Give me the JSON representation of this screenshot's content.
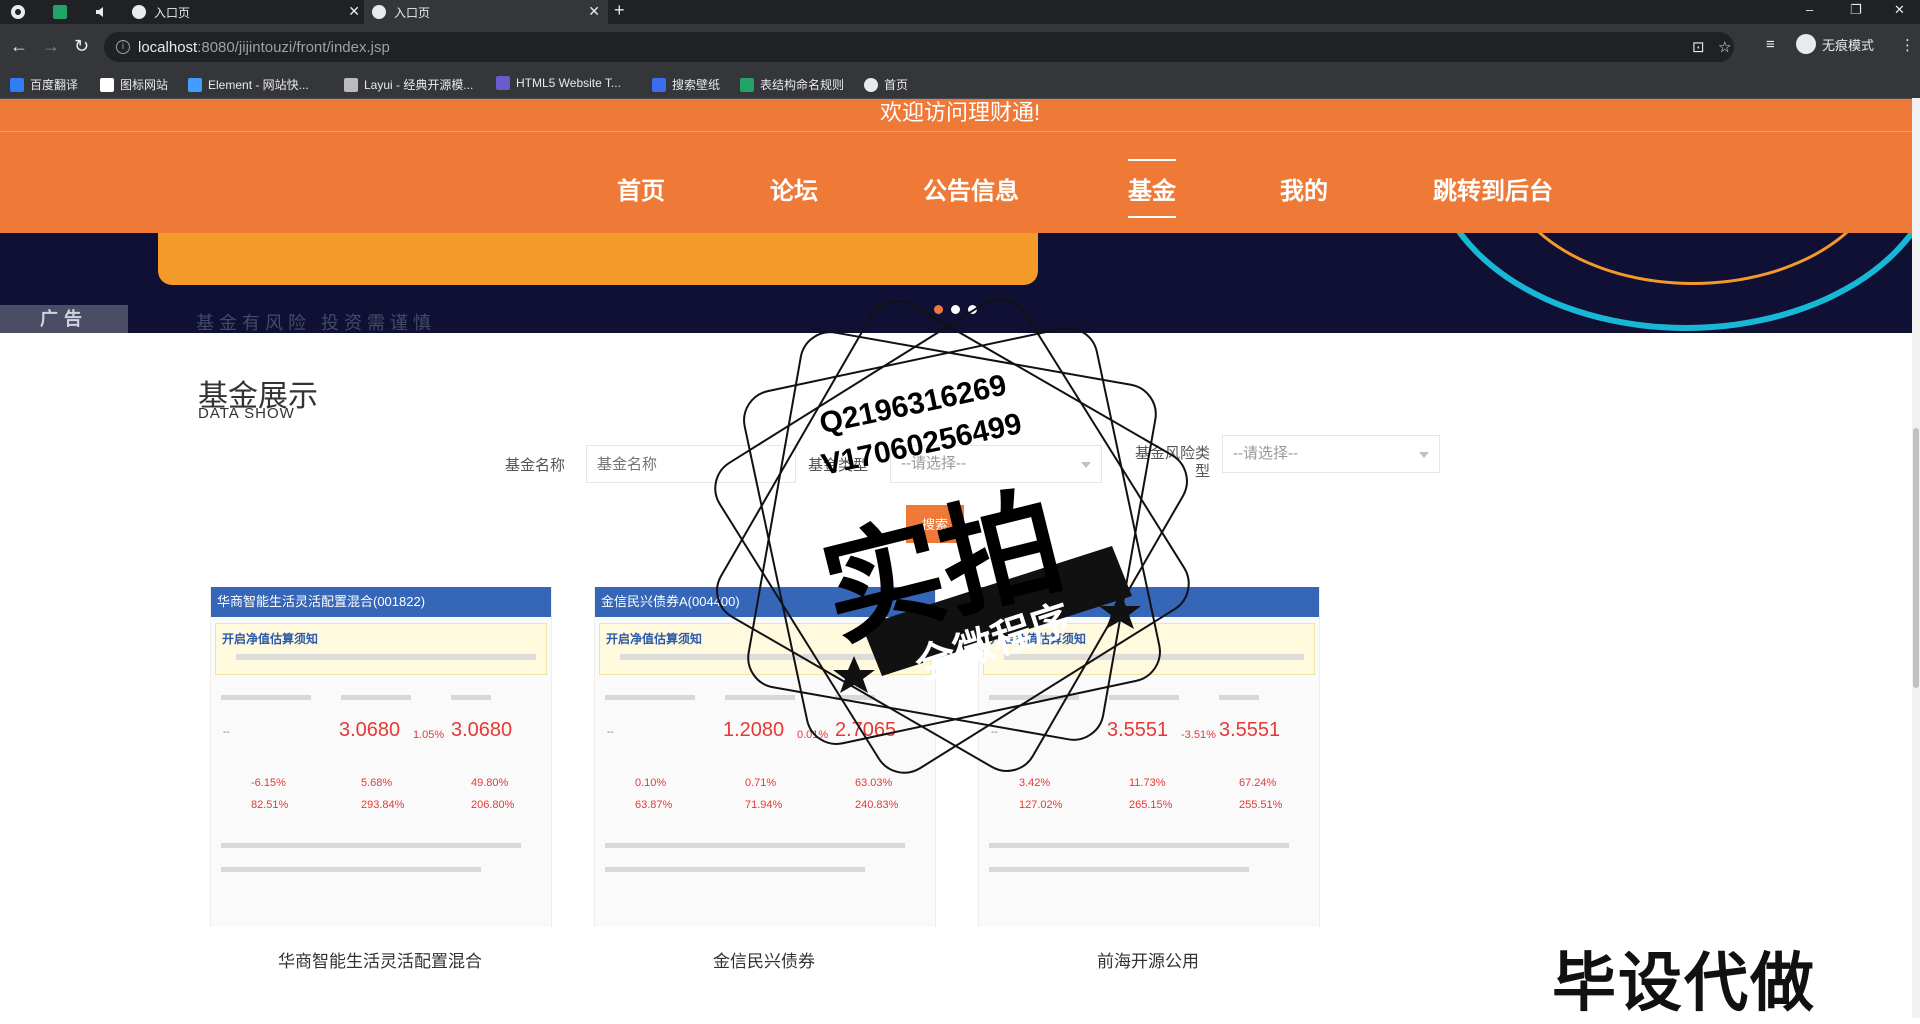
{
  "browser": {
    "tabs": [
      {
        "title": "入口页",
        "active": false
      },
      {
        "title": "入口页",
        "active": true
      }
    ],
    "url_host": "localhost",
    "url_path": ":8080/jijintouzi/front/index.jsp",
    "incognito_label": "无痕模式",
    "bookmarks": [
      {
        "label": "百度翻译",
        "color": "#2f7cf6"
      },
      {
        "label": "图标网站",
        "color": "#ffffff"
      },
      {
        "label": "Element - 网站快...",
        "color": "#409eff"
      },
      {
        "label": "Layui - 经典开源模...",
        "color": "#cccccc"
      },
      {
        "label": "HTML5 Website T...",
        "color": "#6a5acd"
      },
      {
        "label": "搜索壁纸",
        "color": "#3a6df0"
      },
      {
        "label": "表结构命名规则",
        "color": "#21a366"
      },
      {
        "label": "首页",
        "color": "#e8eaed"
      }
    ]
  },
  "site": {
    "welcome": "欢迎访问理财通!",
    "nav": [
      {
        "label": "首页",
        "active": false
      },
      {
        "label": "论坛",
        "active": false
      },
      {
        "label": "公告信息",
        "active": false
      },
      {
        "label": "基金",
        "active": true
      },
      {
        "label": "我的",
        "active": false
      },
      {
        "label": "跳转到后台",
        "active": false
      }
    ],
    "banner": {
      "ad_label": "广告",
      "risk_text": "基金有风险 投资需谨慎"
    }
  },
  "section": {
    "title": "基金展示",
    "subtitle": "DATA SHOW"
  },
  "filters": {
    "name_label": "基金名称",
    "name_placeholder": "基金名称",
    "type_label": "基金类型",
    "type_value": "--请选择--",
    "risk_label": "基金风险类型",
    "risk_value": "--请选择--",
    "search_label": "搜索"
  },
  "funds": [
    {
      "name": "华商智能生活灵活配置混合",
      "img_title": "华商智能生活灵活配置混合(001822)",
      "notice": "开启净值估算须知",
      "nav": "3.0680",
      "change": "1.05%",
      "total": "3.0680",
      "r1": "-6.15%",
      "r2": "5.68%",
      "r3": "49.80%",
      "r4": "82.51%",
      "r5": "293.84%",
      "r6": "206.80%"
    },
    {
      "name": "金信民兴债券",
      "img_title": "金信民兴债券A(004400)",
      "notice": "开启净值估算须知",
      "nav": "1.2080",
      "change": "0.01%",
      "total": "2.7065",
      "r1": "0.10%",
      "r2": "0.71%",
      "r3": "63.03%",
      "r4": "63.87%",
      "r5": "71.94%",
      "r6": "240.83%"
    },
    {
      "name": "前海开源公用",
      "img_title": "前海开源公用",
      "notice": "开启净值估算须知",
      "nav": "3.5551",
      "change": "-3.51%",
      "total": "3.5551",
      "r1": "3.42%",
      "r2": "11.73%",
      "r3": "67.24%",
      "r4": "127.02%",
      "r5": "265.15%",
      "r6": "255.51%"
    }
  ],
  "watermark": {
    "qq": "Q2196316269",
    "vx": "V17060256499",
    "big": "实拍",
    "banner": "全微程序",
    "corner": "毕设代做"
  },
  "colors": {
    "accent": "#ef7a38",
    "fund_header": "#3566b8",
    "up_red": "#e53935"
  }
}
